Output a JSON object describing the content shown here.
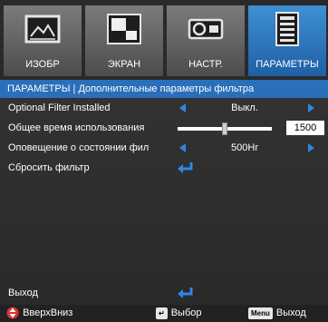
{
  "tabs": [
    {
      "label": "ИЗОБР",
      "icon": "picture-icon",
      "active": false
    },
    {
      "label": "ЭКРАН",
      "icon": "display-icon",
      "active": false
    },
    {
      "label": "НАСТР.",
      "icon": "projector-icon",
      "active": false
    },
    {
      "label": "ПАРАМЕТРЫ",
      "icon": "options-icon",
      "active": true
    }
  ],
  "header": {
    "title": "ПАРАМЕТРЫ | Дополнительные параметры фильтра"
  },
  "rows": {
    "filter_installed": {
      "label": "Optional Filter Installed",
      "value": "Выкл."
    },
    "usage_time": {
      "label": "Общее время использования",
      "value": "1500",
      "level": 0.5
    },
    "reminder": {
      "label": "Оповещение о состоянии фил",
      "value": "500Hr"
    },
    "reset": {
      "label": "Сбросить фильтр"
    },
    "exit": {
      "label": "Выход"
    }
  },
  "footer": {
    "updown": "ВверхВниз",
    "select": "Выбор",
    "menu_badge": "Menu",
    "exit": "Выход"
  },
  "colors": {
    "accent": "#2f86e6",
    "header": "#2a6fba",
    "active_tab": "#2f7fc9"
  }
}
